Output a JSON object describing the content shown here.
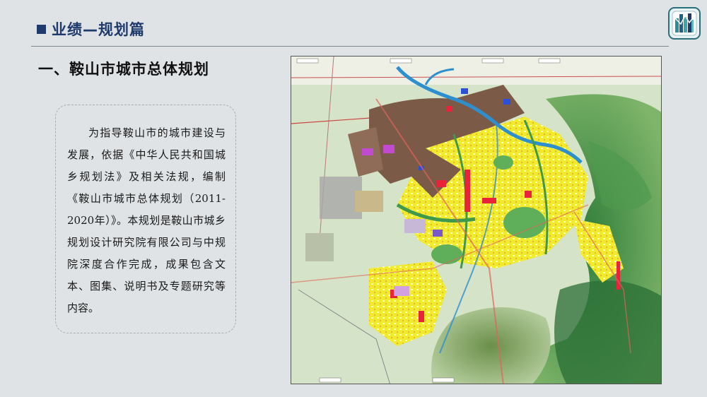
{
  "header": {
    "title": "业绩—规划篇"
  },
  "section": {
    "title": "一、鞍山市城市总体规划"
  },
  "body": {
    "paragraph": "为指导鞍山市的城市建设与发展，依据《中华人民共和国城乡规划法》及相关法规，编制《鞍山市城市总体规划（2011-2020年）》。本规划是鞍山市城乡规划设计研究院有限公司与中规院深度合作完成，成果包含文本、图集、说明书及专题研究等内容。"
  },
  "colors": {
    "accent": "#1f3a6b",
    "logo_teal": "#2a8f9a",
    "map_residential": "#f2ea2c",
    "map_industrial": "#7b5a48",
    "map_commercial": "#e8233a",
    "map_green": "#3e9a4a",
    "map_water": "#2e8fcf"
  },
  "icons": {
    "logo": "building-logo-icon",
    "bullet": "square-bullet-icon"
  }
}
